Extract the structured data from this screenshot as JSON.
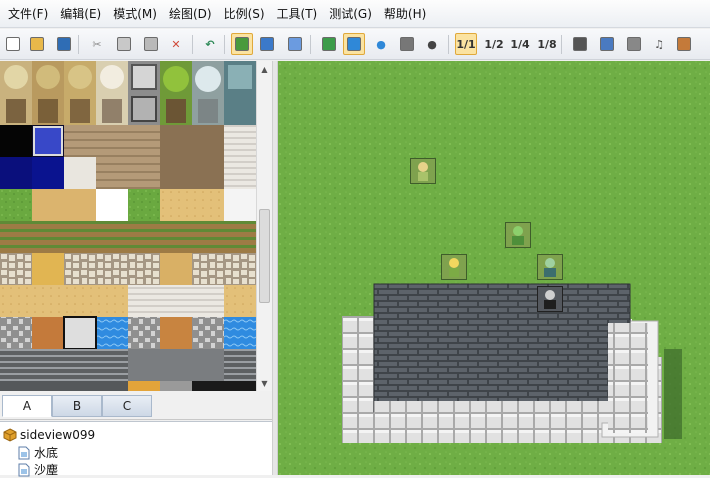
{
  "menu": [
    "文件(F)",
    "编辑(E)",
    "模式(M)",
    "绘图(D)",
    "比例(S)",
    "工具(T)",
    "测试(G)",
    "帮助(H)"
  ],
  "toolbar": {
    "buttons": [
      {
        "name": "new-project-button",
        "glyph": "",
        "color": "#ffffff",
        "active": false
      },
      {
        "name": "open-project-button",
        "glyph": "",
        "color": "#e8b84a",
        "active": false
      },
      {
        "name": "save-project-button",
        "glyph": "",
        "color": "#2f6db5",
        "active": false
      },
      {
        "name": "cut-button",
        "glyph": "✂",
        "color": "#8a8a8a",
        "active": false
      },
      {
        "name": "copy-button",
        "glyph": "",
        "color": "#c8c8c8",
        "active": false
      },
      {
        "name": "paste-button",
        "glyph": "",
        "color": "#b9b9b9",
        "active": false
      },
      {
        "name": "delete-button",
        "glyph": "✕",
        "color": "#d04a3a",
        "active": false
      },
      {
        "name": "undo-button",
        "glyph": "↶",
        "color": "#2e8a58",
        "active": false
      },
      {
        "name": "map-mode-button",
        "glyph": "",
        "color": "#4a9a3c",
        "active": true
      },
      {
        "name": "event-mode-button",
        "glyph": "",
        "color": "#3b79c9",
        "active": false
      },
      {
        "name": "region-mode-button",
        "glyph": "",
        "color": "#6b9be0",
        "active": false
      },
      {
        "name": "pencil-tool-button",
        "glyph": "",
        "color": "#3c9c4a",
        "active": false
      },
      {
        "name": "rectangle-tool-button",
        "glyph": "",
        "color": "#2f88d8",
        "active": true
      },
      {
        "name": "ellipse-tool-button",
        "glyph": "●",
        "color": "#2f88d8",
        "active": false
      },
      {
        "name": "fill-tool-button",
        "glyph": "",
        "color": "#777777",
        "active": false
      },
      {
        "name": "shadow-pen-button",
        "glyph": "●",
        "color": "#444444",
        "active": false
      },
      {
        "name": "zoom-1-1-button",
        "glyph": "1/1",
        "color": "#333333",
        "active": true
      },
      {
        "name": "zoom-1-2-button",
        "glyph": "1/2",
        "color": "#333333",
        "active": false
      },
      {
        "name": "zoom-1-4-button",
        "glyph": "1/4",
        "color": "#333333",
        "active": false
      },
      {
        "name": "zoom-1-8-button",
        "glyph": "1/8",
        "color": "#333333",
        "active": false
      },
      {
        "name": "database-button",
        "glyph": "",
        "color": "#555555",
        "active": false
      },
      {
        "name": "plugin-manager-button",
        "glyph": "",
        "color": "#4a7ac0",
        "active": false
      },
      {
        "name": "event-searcher-button",
        "glyph": "",
        "color": "#888888",
        "active": false
      },
      {
        "name": "sound-test-button",
        "glyph": "♫",
        "color": "#555555",
        "active": false
      },
      {
        "name": "character-generator-button",
        "glyph": "",
        "color": "#c47a3a",
        "active": false
      }
    ]
  },
  "tileset_tabs": [
    "A",
    "B",
    "C"
  ],
  "map_tree": [
    {
      "label": "sideview099",
      "level": 0
    },
    {
      "label": "水底",
      "level": 1
    },
    {
      "label": "沙塵",
      "level": 1
    }
  ],
  "colors": {
    "grass": "#6fae45",
    "brick_dark": "#555a61",
    "stone_light": "#dfdfdf",
    "selection": "#fbe3a1"
  }
}
